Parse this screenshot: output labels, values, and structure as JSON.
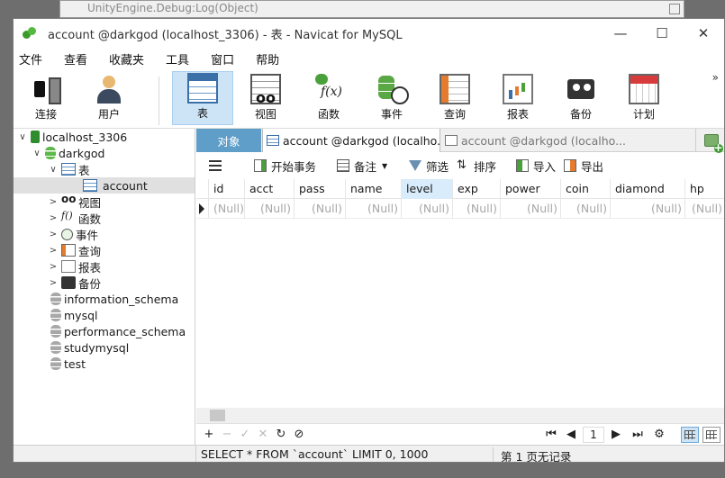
{
  "background_window": {
    "title": "UnityEngine.Debug:Log(Object)"
  },
  "window": {
    "title": "account @darkgod (localhost_3306) - 表 - Navicat for MySQL",
    "controls": [
      "—",
      "☐",
      "✕"
    ]
  },
  "menu": [
    "文件",
    "查看",
    "收藏夹",
    "工具",
    "窗口",
    "帮助"
  ],
  "toolbar": {
    "buttons": [
      {
        "label": "连接",
        "icon": "plug-icon"
      },
      {
        "label": "用户",
        "icon": "user-icon"
      },
      {
        "label": "表",
        "icon": "table-icon",
        "active": true
      },
      {
        "label": "视图",
        "icon": "view-icon"
      },
      {
        "label": "函数",
        "icon": "function-icon"
      },
      {
        "label": "事件",
        "icon": "event-icon"
      },
      {
        "label": "查询",
        "icon": "query-icon"
      },
      {
        "label": "报表",
        "icon": "report-icon"
      },
      {
        "label": "备份",
        "icon": "backup-icon"
      },
      {
        "label": "计划",
        "icon": "schedule-icon"
      }
    ],
    "more": "»"
  },
  "tree": [
    {
      "label": "localhost_3306",
      "level": 0,
      "twisty": "∨",
      "icon": "server"
    },
    {
      "label": "darkgod",
      "level": 1,
      "twisty": "∨",
      "icon": "db"
    },
    {
      "label": "表",
      "level": 2,
      "twisty": "∨",
      "icon": "table"
    },
    {
      "label": "account",
      "level": 3,
      "twisty": "",
      "icon": "table",
      "selected": true
    },
    {
      "label": "视图",
      "level": 2,
      "twisty": ">",
      "icon": "view"
    },
    {
      "label": "函数",
      "level": 2,
      "twisty": ">",
      "icon": "func"
    },
    {
      "label": "事件",
      "level": 2,
      "twisty": ">",
      "icon": "event"
    },
    {
      "label": "查询",
      "level": 2,
      "twisty": ">",
      "icon": "query"
    },
    {
      "label": "报表",
      "level": 2,
      "twisty": ">",
      "icon": "report"
    },
    {
      "label": "备份",
      "level": 2,
      "twisty": ">",
      "icon": "backup"
    },
    {
      "label": "information_schema",
      "level": 1,
      "twisty": "",
      "icon": "dbgray"
    },
    {
      "label": "mysql",
      "level": 1,
      "twisty": "",
      "icon": "dbgray"
    },
    {
      "label": "performance_schema",
      "level": 1,
      "twisty": "",
      "icon": "dbgray"
    },
    {
      "label": "studymysql",
      "level": 1,
      "twisty": "",
      "icon": "dbgray"
    },
    {
      "label": "test",
      "level": 1,
      "twisty": "",
      "icon": "dbgray"
    }
  ],
  "tabs": {
    "objects": "对象",
    "tab1": "account @darkgod (localho...",
    "tab2": "account @darkgod (localho..."
  },
  "gridbar": {
    "begin_tx": "开始事务",
    "memo": "备注",
    "filter": "筛选",
    "sort": "排序",
    "import": "导入",
    "export": "导出"
  },
  "grid": {
    "columns": [
      "id",
      "acct",
      "pass",
      "name",
      "level",
      "exp",
      "power",
      "coin",
      "diamond",
      "hp"
    ],
    "highlight_column": "level",
    "rows": [
      [
        "(Null)",
        "(Null)",
        "(Null)",
        "(Null)",
        "(Null)",
        "(Null)",
        "(Null)",
        "(Null)",
        "(Null)",
        "(Null)"
      ]
    ]
  },
  "navbar": {
    "buttons": [
      "+",
      "−",
      "✓",
      "✕",
      "↻",
      "⊘"
    ],
    "paging": [
      "⏮",
      "◀",
      "▶",
      "⏭",
      "⚙"
    ],
    "page": "1"
  },
  "status": {
    "sql": "SELECT * FROM `account` LIMIT 0, 1000",
    "page_info": "第 1 页无记录"
  }
}
